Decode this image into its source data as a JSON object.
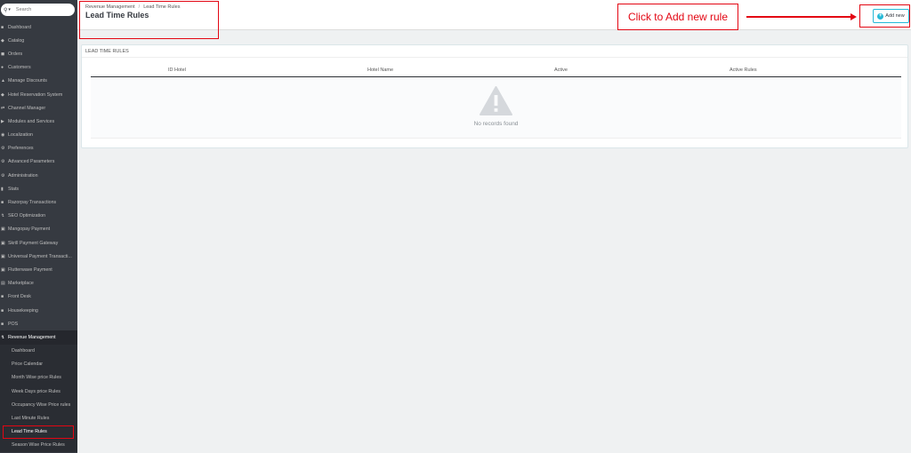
{
  "search": {
    "placeholder": "Search"
  },
  "sidebar": {
    "items": [
      {
        "label": "Dashboard",
        "icon": "dashboard-icon"
      },
      {
        "label": "Catalog",
        "icon": "catalog-icon"
      },
      {
        "label": "Orders",
        "icon": "orders-icon"
      },
      {
        "label": "Customers",
        "icon": "customers-icon"
      },
      {
        "label": "Manage Discounts",
        "icon": "discounts-icon"
      },
      {
        "label": "Hotel Reservation System",
        "icon": "hotel-icon"
      },
      {
        "label": "Channel Manager",
        "icon": "channel-icon"
      },
      {
        "label": "Modules and Services",
        "icon": "modules-icon"
      },
      {
        "label": "Localization",
        "icon": "localization-icon"
      },
      {
        "label": "Preferences",
        "icon": "preferences-icon"
      },
      {
        "label": "Advanced Parameters",
        "icon": "parameters-icon"
      },
      {
        "label": "Administration",
        "icon": "administration-icon"
      },
      {
        "label": "Stats",
        "icon": "stats-icon"
      },
      {
        "label": "Razorpay Transactions",
        "icon": "razorpay-icon"
      },
      {
        "label": "SEO Optimization",
        "icon": "seo-icon"
      },
      {
        "label": "Mangopay Payment",
        "icon": "mangopay-icon"
      },
      {
        "label": "Skrill Payment Gateway",
        "icon": "skrill-icon"
      },
      {
        "label": "Universal Payment Transacti...",
        "icon": "payment-icon"
      },
      {
        "label": "Flutterwave Payment",
        "icon": "flutterwave-icon"
      },
      {
        "label": "Marketplace",
        "icon": "marketplace-icon"
      },
      {
        "label": "Front Desk",
        "icon": "frontdesk-icon"
      },
      {
        "label": "Housekeeping",
        "icon": "housekeeping-icon"
      },
      {
        "label": "POS",
        "icon": "pos-icon"
      },
      {
        "label": "Revenue Management",
        "icon": "revenue-icon"
      }
    ],
    "subitems": [
      "Dashboard",
      "Price Calendar",
      "Month Wise price Rules",
      "Week Days price Rules",
      "Occupancy Wise Price rules",
      "Last Minute Rules",
      "Lead Time Rules",
      "Season Wise Price Rules"
    ]
  },
  "header": {
    "breadcrumb": [
      "Revenue Management",
      "Lead Time Rules"
    ],
    "title": "Lead Time Rules",
    "add_label": "Add new"
  },
  "annotation": {
    "text": "Click to Add new rule",
    "color": "#e30613"
  },
  "panel": {
    "title": "LEAD TIME RULES",
    "columns": [
      "ID Hotel",
      "Hotel Name",
      "Active",
      "Active Rules"
    ],
    "empty_text": "No records found"
  },
  "colors": {
    "sidebar": "#363a41",
    "accent": "#25b9d7",
    "highlight": "#e30613"
  }
}
